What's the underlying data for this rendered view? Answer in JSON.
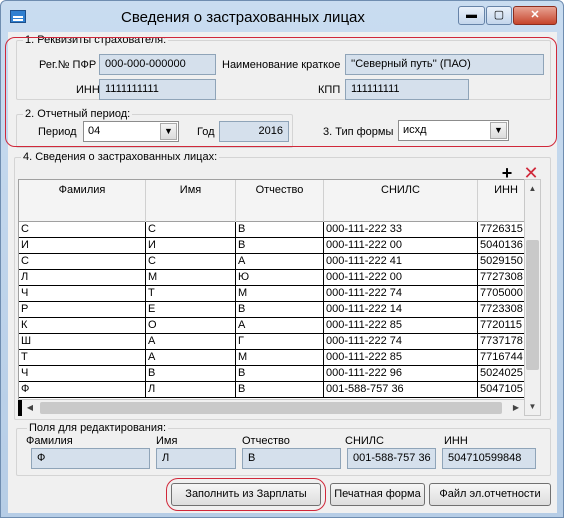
{
  "window": {
    "title": "Сведения о застрахованных лицах"
  },
  "group1": {
    "label": "1. Реквизиты страхователя:",
    "pfr_label": "Рег.№ ПФР",
    "pfr_value": "000-000-000000",
    "short_name_label": "Наименование краткое",
    "short_name_value": "''Северный путь'' (ПАО)",
    "inn_label": "ИНН",
    "inn_value": "1111111111",
    "kpp_label": "КПП",
    "kpp_value": "111111111"
  },
  "group2": {
    "label": "2. Отчетный период:",
    "period_label": "Период",
    "period_value": "04",
    "year_label": "Год",
    "year_value": "2016"
  },
  "form_type": {
    "label": "3. Тип формы",
    "value": "исхд"
  },
  "group4": {
    "label": "4. Сведения о застрахованных лицах:",
    "add_icon": "plus-icon",
    "delete_icon": "delete-x-icon"
  },
  "table": {
    "columns": [
      "Фамилия",
      "Имя",
      "Отчество",
      "СНИЛС",
      "ИНН"
    ],
    "rows": [
      [
        "С",
        "С",
        "В",
        "000-111-222 33",
        "7726315"
      ],
      [
        "И",
        "И",
        "В",
        "000-111-222 00",
        "5040136"
      ],
      [
        "С",
        "С",
        "А",
        "000-111-222 41",
        "5029150"
      ],
      [
        "Л",
        "М",
        "Ю",
        "000-111-222 00",
        "7727308"
      ],
      [
        "Ч",
        "Т",
        "М",
        "000-111-222 74",
        "7705000"
      ],
      [
        "Р",
        "Е",
        "В",
        "000-111-222 14",
        "7723308"
      ],
      [
        "К",
        "О",
        "А",
        "000-111-222 85",
        "7720115"
      ],
      [
        "Ш",
        "А",
        "Г",
        "000-111-222 74",
        "7737178"
      ],
      [
        "Т",
        "А",
        "М",
        "000-111-222 85",
        "7716744"
      ],
      [
        "Ч",
        "В",
        "В",
        "000-111-222 96",
        "5024025"
      ],
      [
        "Ф",
        "Л",
        "В",
        "001-588-757 36",
        "5047105"
      ]
    ]
  },
  "edit": {
    "label": "Поля для редактирования:",
    "fam_label": "Фамилия",
    "name_label": "Имя",
    "otch_label": "Отчество",
    "snils_label": "СНИЛС",
    "inn_label": "ИНН",
    "fam_value": "Ф",
    "name_value": "Л",
    "otch_value": "В",
    "snils_value": "001-588-757 36",
    "inn_value": "504710599848"
  },
  "buttons": {
    "fill": "Заполнить из Зарплаты",
    "print": "Печатная форма",
    "report": "Файл эл.отчетности"
  },
  "colors": {
    "highlight_outline": "#d0283a",
    "field_bg": "#d5e0ec",
    "delete": "#d0283a"
  }
}
